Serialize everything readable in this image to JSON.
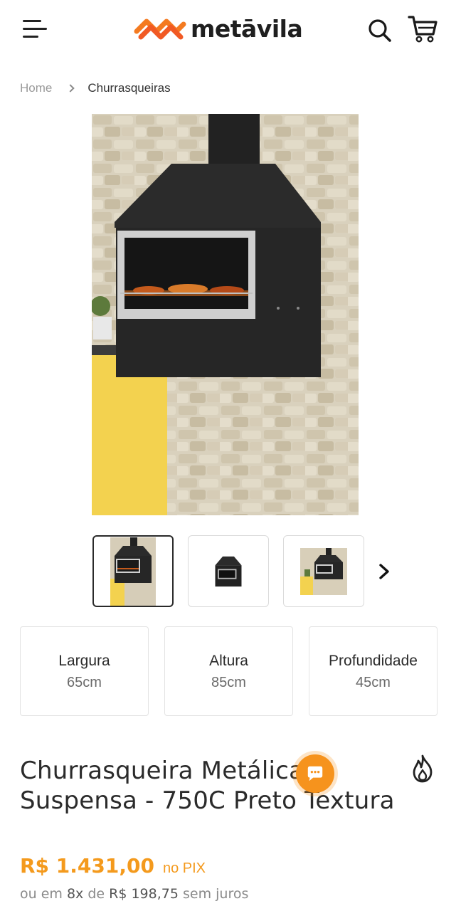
{
  "header": {
    "brand": "metāvila",
    "menu_icon": "hamburger-menu-icon",
    "search_icon": "search-icon",
    "cart_icon": "shopping-cart-icon",
    "brand_color": "#f47a20"
  },
  "breadcrumb": {
    "home": "Home",
    "current": "Churrasqueiras"
  },
  "gallery": {
    "thumbnail_count": 3,
    "next_icon": "chevron-right-icon"
  },
  "dimensions": [
    {
      "label": "Largura",
      "value": "65cm"
    },
    {
      "label": "Altura",
      "value": "85cm"
    },
    {
      "label": "Profundidade",
      "value": "45cm"
    }
  ],
  "product": {
    "title_line1": "Churrasqueira Metálica",
    "title_line2": "Suspensa - 750C Preto Textura",
    "badge_icon": "flame-icon"
  },
  "pricing": {
    "price": "R$ 1.431,00",
    "pix_label": "no PIX",
    "installments_prefix": "ou em",
    "installments_count": "8x",
    "installments_of": "de",
    "installment_value": "R$ 198,75",
    "installments_suffix": "sem juros",
    "accent_color": "#f49a1d"
  },
  "chat": {
    "icon": "chat-bubble-icon",
    "color": "#f6931d"
  }
}
